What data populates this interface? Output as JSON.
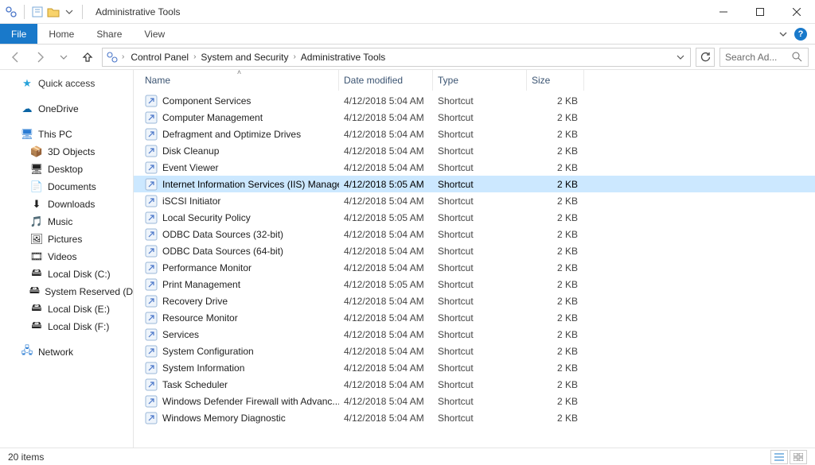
{
  "title": "Administrative Tools",
  "ribbon": {
    "file": "File",
    "tabs": [
      "Home",
      "Share",
      "View"
    ]
  },
  "breadcrumbs": [
    "Control Panel",
    "System and Security",
    "Administrative Tools"
  ],
  "search": {
    "placeholder": "Search Ad..."
  },
  "columns": {
    "name": "Name",
    "date": "Date modified",
    "type": "Type",
    "size": "Size"
  },
  "sidebar": {
    "quick": "Quick access",
    "onedrive": "OneDrive",
    "thispc": "This PC",
    "pc_children": [
      {
        "label": "3D Objects",
        "icon": "📦"
      },
      {
        "label": "Desktop",
        "icon": "🖥"
      },
      {
        "label": "Documents",
        "icon": "📄"
      },
      {
        "label": "Downloads",
        "icon": "⬇"
      },
      {
        "label": "Music",
        "icon": "🎵"
      },
      {
        "label": "Pictures",
        "icon": "🖼"
      },
      {
        "label": "Videos",
        "icon": "🎞"
      },
      {
        "label": "Local Disk (C:)",
        "icon": "🖴"
      },
      {
        "label": "System Reserved (D",
        "icon": "🖴"
      },
      {
        "label": "Local Disk (E:)",
        "icon": "🖴"
      },
      {
        "label": "Local Disk (F:)",
        "icon": "🖴"
      }
    ],
    "network": "Network"
  },
  "items": [
    {
      "name": "Component Services",
      "date": "4/12/2018 5:04 AM",
      "type": "Shortcut",
      "size": "2 KB",
      "selected": false
    },
    {
      "name": "Computer Management",
      "date": "4/12/2018 5:04 AM",
      "type": "Shortcut",
      "size": "2 KB",
      "selected": false
    },
    {
      "name": "Defragment and Optimize Drives",
      "date": "4/12/2018 5:04 AM",
      "type": "Shortcut",
      "size": "2 KB",
      "selected": false
    },
    {
      "name": "Disk Cleanup",
      "date": "4/12/2018 5:04 AM",
      "type": "Shortcut",
      "size": "2 KB",
      "selected": false
    },
    {
      "name": "Event Viewer",
      "date": "4/12/2018 5:04 AM",
      "type": "Shortcut",
      "size": "2 KB",
      "selected": false
    },
    {
      "name": "Internet Information Services (IIS) Manager",
      "date": "4/12/2018 5:05 AM",
      "type": "Shortcut",
      "size": "2 KB",
      "selected": true
    },
    {
      "name": "iSCSI Initiator",
      "date": "4/12/2018 5:04 AM",
      "type": "Shortcut",
      "size": "2 KB",
      "selected": false
    },
    {
      "name": "Local Security Policy",
      "date": "4/12/2018 5:05 AM",
      "type": "Shortcut",
      "size": "2 KB",
      "selected": false
    },
    {
      "name": "ODBC Data Sources (32-bit)",
      "date": "4/12/2018 5:04 AM",
      "type": "Shortcut",
      "size": "2 KB",
      "selected": false
    },
    {
      "name": "ODBC Data Sources (64-bit)",
      "date": "4/12/2018 5:04 AM",
      "type": "Shortcut",
      "size": "2 KB",
      "selected": false
    },
    {
      "name": "Performance Monitor",
      "date": "4/12/2018 5:04 AM",
      "type": "Shortcut",
      "size": "2 KB",
      "selected": false
    },
    {
      "name": "Print Management",
      "date": "4/12/2018 5:05 AM",
      "type": "Shortcut",
      "size": "2 KB",
      "selected": false
    },
    {
      "name": "Recovery Drive",
      "date": "4/12/2018 5:04 AM",
      "type": "Shortcut",
      "size": "2 KB",
      "selected": false
    },
    {
      "name": "Resource Monitor",
      "date": "4/12/2018 5:04 AM",
      "type": "Shortcut",
      "size": "2 KB",
      "selected": false
    },
    {
      "name": "Services",
      "date": "4/12/2018 5:04 AM",
      "type": "Shortcut",
      "size": "2 KB",
      "selected": false
    },
    {
      "name": "System Configuration",
      "date": "4/12/2018 5:04 AM",
      "type": "Shortcut",
      "size": "2 KB",
      "selected": false
    },
    {
      "name": "System Information",
      "date": "4/12/2018 5:04 AM",
      "type": "Shortcut",
      "size": "2 KB",
      "selected": false
    },
    {
      "name": "Task Scheduler",
      "date": "4/12/2018 5:04 AM",
      "type": "Shortcut",
      "size": "2 KB",
      "selected": false
    },
    {
      "name": "Windows Defender Firewall with Advanc...",
      "date": "4/12/2018 5:04 AM",
      "type": "Shortcut",
      "size": "2 KB",
      "selected": false
    },
    {
      "name": "Windows Memory Diagnostic",
      "date": "4/12/2018 5:04 AM",
      "type": "Shortcut",
      "size": "2 KB",
      "selected": false
    }
  ],
  "status": {
    "count": "20 items"
  }
}
